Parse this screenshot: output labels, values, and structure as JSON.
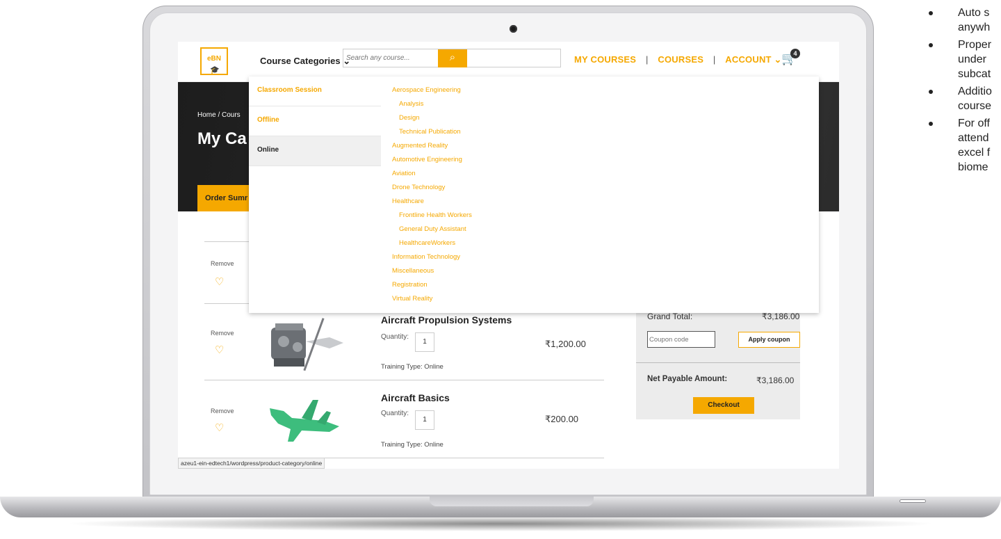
{
  "header": {
    "logo_text": "eBN",
    "categories_label": "Course Categories",
    "categories_chevron": "⌄",
    "search_placeholder": "Search any course...",
    "search_icon": "search-icon",
    "nav": {
      "my_courses": "MY COURSES",
      "courses": "COURSES",
      "account": "ACCOUNT",
      "sep": "|"
    },
    "cart_count": "4"
  },
  "hero": {
    "breadcrumb": "Home / Cours",
    "title": "My Ca",
    "order_tab": "Order Sumr"
  },
  "mega_menu": {
    "delivery_modes": [
      "Classroom Session",
      "Offline",
      "Online"
    ],
    "categories": [
      {
        "label": "Aerospace Engineering",
        "level": 1
      },
      {
        "label": "Analysis",
        "level": 2
      },
      {
        "label": "Design",
        "level": 2
      },
      {
        "label": "Technical Publication",
        "level": 2
      },
      {
        "label": "Augmented Reality",
        "level": 1
      },
      {
        "label": "Automotive Engineering",
        "level": 1
      },
      {
        "label": "Aviation",
        "level": 1
      },
      {
        "label": "Drone Technology",
        "level": 1
      },
      {
        "label": "Healthcare",
        "level": 1
      },
      {
        "label": "Frontline Health Workers",
        "level": 2
      },
      {
        "label": "General Duty Assistant",
        "level": 2
      },
      {
        "label": "HealthcareWorkers",
        "level": 2
      },
      {
        "label": "Information Technology",
        "level": 1
      },
      {
        "label": "Miscellaneous",
        "level": 1
      },
      {
        "label": "Registration",
        "level": 1
      },
      {
        "label": "Virtual Reality",
        "level": 1
      }
    ]
  },
  "cart": {
    "remove_label": "Remove",
    "quantity_label": "Quantity:",
    "items": [
      {
        "title": "",
        "qty": "",
        "type": "",
        "price": ""
      },
      {
        "title": "Aircraft Propulsion Systems",
        "qty": "1",
        "type": "Training Type: Online",
        "price": "₹1,200.00"
      },
      {
        "title": "Aircraft Basics",
        "qty": "1",
        "type": "Training Type: Online",
        "price": "₹200.00"
      }
    ]
  },
  "summary": {
    "grand_total_label": "Grand Total:",
    "grand_total_value": "₹3,186.00",
    "coupon_placeholder": "Coupon code",
    "apply_label": "Apply coupon",
    "net_label": "Net Payable Amount:",
    "net_value": "₹3,186.00",
    "checkout_label": "Checkout"
  },
  "status_url": "azeu1-ein-edtech1/wordpress/product-category/online",
  "notes": [
    [
      "Auto s",
      "anywh"
    ],
    [
      "Proper",
      "under",
      "subcat"
    ],
    [
      "Additio",
      "course"
    ],
    [
      "For off",
      "attend",
      "excel f",
      "biome"
    ]
  ],
  "colors": {
    "accent": "#f5a800",
    "dark_hero": "#222222"
  }
}
